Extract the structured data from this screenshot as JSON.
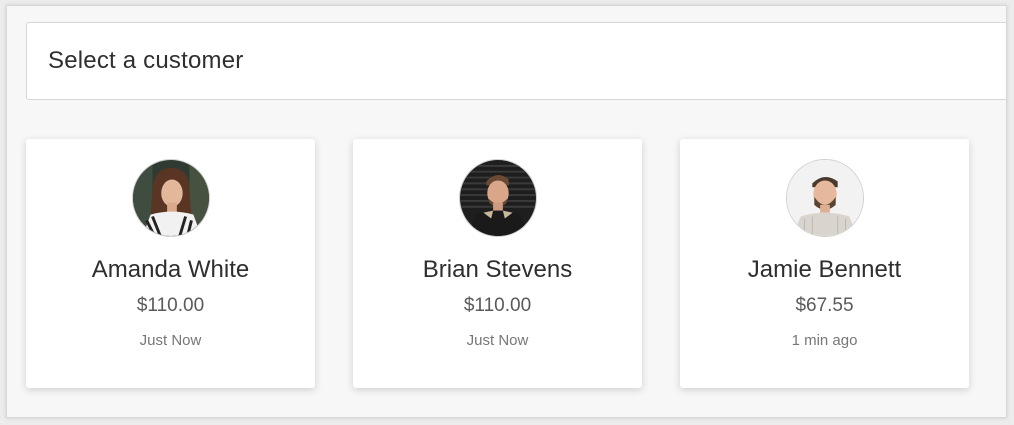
{
  "customer_select": {
    "placeholder": "Select a customer"
  },
  "customers": [
    {
      "name": "Amanda White",
      "amount": "$110.00",
      "time": "Just Now",
      "avatar": "photo of woman"
    },
    {
      "name": "Brian Stevens",
      "amount": "$110.00",
      "time": "Just Now",
      "avatar": "photo of man"
    },
    {
      "name": "Jamie Bennett",
      "amount": "$67.55",
      "time": "1 min ago",
      "avatar": "photo of man"
    }
  ],
  "colors": {
    "page_background": "#f7f7f7",
    "card_background": "#ffffff",
    "text_primary": "#2e2e2e",
    "text_secondary": "#777777"
  }
}
